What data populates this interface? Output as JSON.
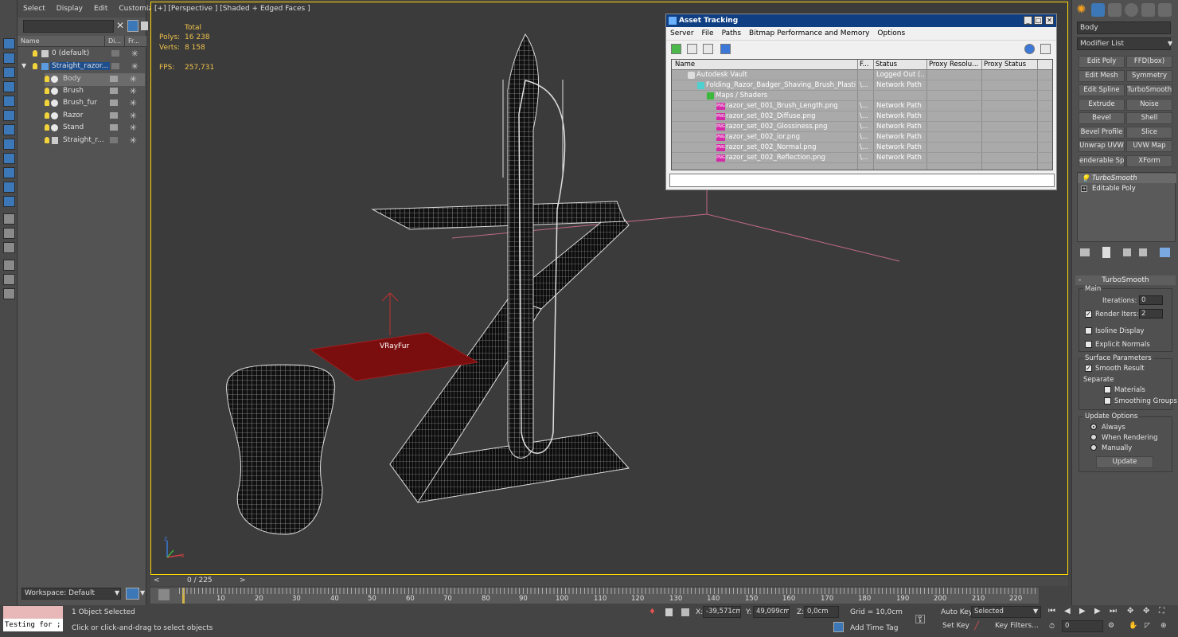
{
  "explorer": {
    "menu": [
      "Select",
      "Display",
      "Edit",
      "Customize"
    ],
    "columns": {
      "name": "Name",
      "display": "Di...",
      "freeze": "Fr..."
    },
    "rows": [
      {
        "label": "0 (default)"
      },
      {
        "label": "Straight_razor..."
      },
      {
        "label": "Body"
      },
      {
        "label": "Brush"
      },
      {
        "label": "Brush_fur"
      },
      {
        "label": "Razor"
      },
      {
        "label": "Stand"
      },
      {
        "label": "Straight_r..."
      }
    ],
    "workspace": "Workspace: Default"
  },
  "viewport": {
    "label": "[+] [Perspective ] [Shaded + Edged Faces ]",
    "stats": {
      "total_label": "Total",
      "polys_label": "Polys:",
      "polys_value": "16 238",
      "verts_label": "Verts:",
      "verts_value": "8 158",
      "fps_label": "FPS:",
      "fps_value": "257,731"
    },
    "vrayfur_label": "VRayFur",
    "axis_z": "z",
    "axis_x": "x"
  },
  "asset_tracking": {
    "title": "Asset Tracking",
    "menu": [
      "Server",
      "File",
      "Paths",
      "Bitmap Performance and Memory",
      "Options"
    ],
    "columns": [
      "Name",
      "F...",
      "Status",
      "Proxy Resolu...",
      "Proxy Status"
    ],
    "rows": [
      {
        "name": "Autodesk Vault",
        "path": "",
        "status": "Logged Out (..."
      },
      {
        "name": "Folding_Razor_Badger_Shaving_Brush_Plastic_...",
        "path": "\\...",
        "status": "Network Path"
      },
      {
        "name": "Maps / Shaders",
        "path": "",
        "status": ""
      },
      {
        "name": "razor_set_001_Brush_Length.png",
        "path": "\\...",
        "status": "Network Path"
      },
      {
        "name": "razor_set_002_Diffuse.png",
        "path": "\\...",
        "status": "Network Path"
      },
      {
        "name": "razor_set_002_Glossiness.png",
        "path": "\\...",
        "status": "Network Path"
      },
      {
        "name": "razor_set_002_ior.png",
        "path": "\\...",
        "status": "Network Path"
      },
      {
        "name": "razor_set_002_Normal.png",
        "path": "\\...",
        "status": "Network Path"
      },
      {
        "name": "razor_set_002_Reflection.png",
        "path": "\\...",
        "status": "Network Path"
      }
    ],
    "png_badge": "PNG"
  },
  "command_panel": {
    "object_name": "Body",
    "modifier_list": "Modifier List",
    "modifier_buttons": [
      "Edit Poly",
      "FFD(box)",
      "Edit Mesh",
      "Symmetry",
      "Edit Spline",
      "TurboSmooth",
      "Extrude",
      "Noise",
      "Bevel",
      "Shell",
      "Bevel Profile",
      "Slice",
      "Unwrap UVW",
      "UVW Map",
      "enderable Splin",
      "XForm"
    ],
    "stack": [
      "TurboSmooth",
      "Editable Poly"
    ],
    "turbosmooth": {
      "title": "TurboSmooth",
      "main": "Main",
      "iterations_label": "Iterations:",
      "iterations_value": "0",
      "render_iters_label": "Render Iters:",
      "render_iters_value": "2",
      "isoline": "Isoline Display",
      "explicit_normals": "Explicit Normals",
      "surface_params": "Surface Parameters",
      "smooth_result": "Smooth Result",
      "separate": "Separate",
      "materials": "Materials",
      "smoothing_groups": "Smoothing Groups",
      "update_options": "Update Options",
      "always": "Always",
      "when_rendering": "When Rendering",
      "manually": "Manually",
      "update_button": "Update"
    }
  },
  "timeline": {
    "frame_display": "0 / 225",
    "ticks": [
      "10",
      "20",
      "30",
      "40",
      "50",
      "60",
      "70",
      "80",
      "90",
      "100",
      "110",
      "120",
      "130",
      "140",
      "150",
      "160",
      "170",
      "180",
      "190",
      "200",
      "210",
      "220"
    ]
  },
  "status": {
    "script_box": "Testing for ;",
    "selection": "1 Object Selected",
    "prompt": "Click or click-and-drag to select objects",
    "x_label": "X:",
    "x_value": "-39,571cm",
    "y_label": "Y:",
    "y_value": "49,099cm",
    "z_label": "Z:",
    "z_value": "0,0cm",
    "grid": "Grid = 10,0cm",
    "add_time_tag": "Add Time Tag",
    "auto_key": "Auto Key",
    "set_key": "Set Key",
    "selected_dropdown": "Selected",
    "key_filters": "Key Filters...",
    "frame_field": "0"
  }
}
